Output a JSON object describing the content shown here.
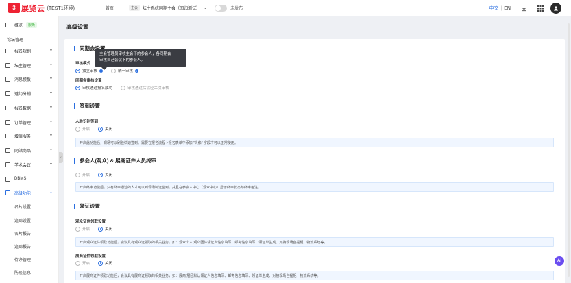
{
  "header": {
    "logo_mark": "3",
    "logo_text": "展览云",
    "env": "(TEST1环境)",
    "home": "首页",
    "context_tag": "主会",
    "context_name": "坛主系统同期主会（回归测试）",
    "toggle_label": "未发布",
    "lang_cn": "中文",
    "lang_sep": "|",
    "lang_en": "EN"
  },
  "sidebar": {
    "overview": "概览",
    "overview_badge": "限免",
    "forum_manage": "论坛管理",
    "items": [
      "报名规划",
      "坛主管理",
      "消息模板",
      "邀约分销",
      "报名数据",
      "订单管理",
      "增值服务",
      "网站商品",
      "学术会议"
    ],
    "dbms": "DBMS",
    "advanced": "高级功能",
    "sub_items": [
      "名片设置",
      "追踪设置",
      "名片报告",
      "追踪报告",
      "待办管理",
      "防疫信息"
    ]
  },
  "main": {
    "page_title": "高级设置",
    "tooltip_line1": "主会管理员审核主会下的参会人，各同期会",
    "tooltip_line2": "审核自己会议下的参会人。",
    "sections": {
      "sync": {
        "title": "同期会设置",
        "audit_mode_label": "审核模式",
        "audit_opt1": "独立审核",
        "audit_opt2": "统一审核",
        "sync_audit_label": "同期会审核设置",
        "sync_opt1": "审核通过报名成功",
        "sync_opt2": "审核通过后需经二次审核"
      },
      "checkin": {
        "title": "签到设置",
        "face_label": "人脸识别签到",
        "on": "开启",
        "off": "关闭",
        "notice": "开启此功能后，现场可以刷脸快速签到。需要在报名流程->报名表单中添加 \"头像\" 字段才可以正常使用。"
      },
      "attendee": {
        "title": "参会人(观众) & 展商证件人员终审",
        "on": "开启",
        "off": "关闭",
        "notice": "开启终审功能后，只有终审通过的人才可以到现场制证签到，并且在参会人中心（观众中心）显示终审状态与终审备注。"
      },
      "pickup": {
        "title": "领证设置",
        "visitor_label": "观众证件领取设置",
        "on": "开启",
        "off": "关闭",
        "visitor_notice": "开启观众证件领取功能后，会议具有观众证领取的相关业务，如：观众个人/观众团体领证人信息填写、邮寄信息填写、领证单生成、对接现场自提柜、物流系统等。",
        "exhibitor_label": "展商证件领取设置",
        "exhibitor_notice": "开启展商证件领取功能后，会议具有展商证领取的相关业务，如：展商/展团默认领证人信息填写、邮寄信息填写、领证单生成、对接现场自提柜、物流系统等。"
      }
    }
  },
  "ai_label": "Ai"
}
